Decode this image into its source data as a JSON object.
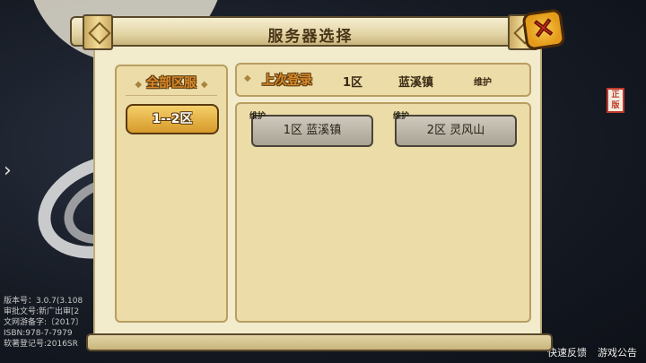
{
  "dialog": {
    "title": "服务器选择",
    "close_icon": "close-x-icon"
  },
  "left_panel": {
    "header": "全部区服",
    "ranges": [
      {
        "label": "1--2区",
        "selected": true
      }
    ]
  },
  "last_login": {
    "label": "上次登录",
    "zone": "1区",
    "name": "蓝溪镇",
    "status": "维护"
  },
  "servers": [
    {
      "status": "维护",
      "label": "1区 蓝溪镇"
    },
    {
      "status": "维护",
      "label": "2区 灵风山"
    }
  ],
  "background": {
    "version_lines": [
      "版本号：3.0.7(3.108",
      "审批文号:新广出审[2",
      "文网游备字:〔2017〕",
      "ISBN:978-7-7979",
      "软著登记号:2016SR"
    ],
    "feedback_label": "快速反馈",
    "notice_label": "游戏公告",
    "badge": "正版"
  },
  "colors": {
    "accent_orange": "#d9892a",
    "parchment": "#ecdca8",
    "gold_button": "#f5cf6a",
    "close_red": "#d62a16"
  }
}
